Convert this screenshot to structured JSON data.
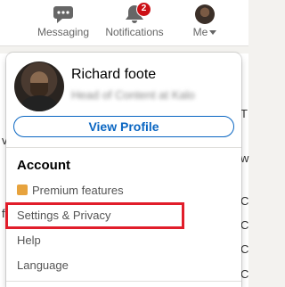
{
  "nav": {
    "partial_label": "s",
    "messaging_label": "Messaging",
    "notifications_label": "Notifications",
    "notifications_badge": "2",
    "me_label": "Me"
  },
  "background": {
    "right_fragments": [
      "T",
      "w",
      "C",
      "C",
      "C",
      "C"
    ],
    "left_fragments": [
      "v",
      "f"
    ]
  },
  "menu": {
    "profile_name": "Richard foote",
    "profile_headline": "Head of Content at Kalo",
    "view_profile_label": "View Profile",
    "account_title": "Account",
    "premium_label": "Premium features",
    "settings_label": "Settings & Privacy",
    "help_label": "Help",
    "language_label": "Language"
  },
  "colors": {
    "accent": "#0a66c2",
    "badge": "#cc1016",
    "highlight": "#e11d2a",
    "premium": "#e7a33e"
  }
}
